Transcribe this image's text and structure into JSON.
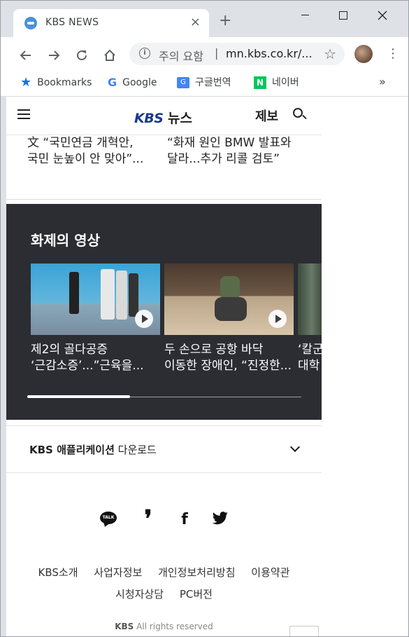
{
  "browser": {
    "tab_title": "KBS NEWS",
    "tab_close": "×",
    "new_tab": "+",
    "omnibox": {
      "warning": "주의 요함",
      "separator": "|",
      "url": "mn.kbs.co.kr/..."
    },
    "bookmarks": [
      {
        "label": "Bookmarks",
        "icon": "star-icon"
      },
      {
        "label": "Google",
        "icon": "google-icon"
      },
      {
        "label": "구글번역",
        "icon": "google-translate-icon"
      },
      {
        "label": "네이버",
        "icon": "naver-icon"
      }
    ],
    "bookmarks_overflow": "»"
  },
  "site": {
    "logo_kbs": "KBS",
    "logo_news": "뉴스",
    "report": "제보"
  },
  "news_items": [
    {
      "line1": "文 “국민연금 개혁안,",
      "line2": "국민 눈높이 안 맞아”..."
    },
    {
      "line1": "“화재 원인 BMW 발표와",
      "line2": "달라...추가 리콜 검토”"
    }
  ],
  "video_section": {
    "title": "화제의 영상",
    "progress_fraction": 0.375,
    "videos": [
      {
        "line1": "제2의 골다공증",
        "line2": "‘근감소증’...”근육을..."
      },
      {
        "line1": "두 손으로 공항 바닥",
        "line2": "이동한 장애인, “진정한..."
      },
      {
        "line1": "‘칼군",
        "line2": "대학"
      }
    ]
  },
  "app_download": {
    "bold": "KBS 애플리케이션",
    "rest": " 다운로드"
  },
  "social": {
    "kakaotalk": "TALK"
  },
  "footer": {
    "links_row1": [
      "KBS소개",
      "사업자정보",
      "개인정보처리방침",
      "이용약관"
    ],
    "links_row2": [
      "시청자상담",
      "PC버전"
    ],
    "copyright_brand": "KBS",
    "copyright_text": " All rights reserved"
  }
}
